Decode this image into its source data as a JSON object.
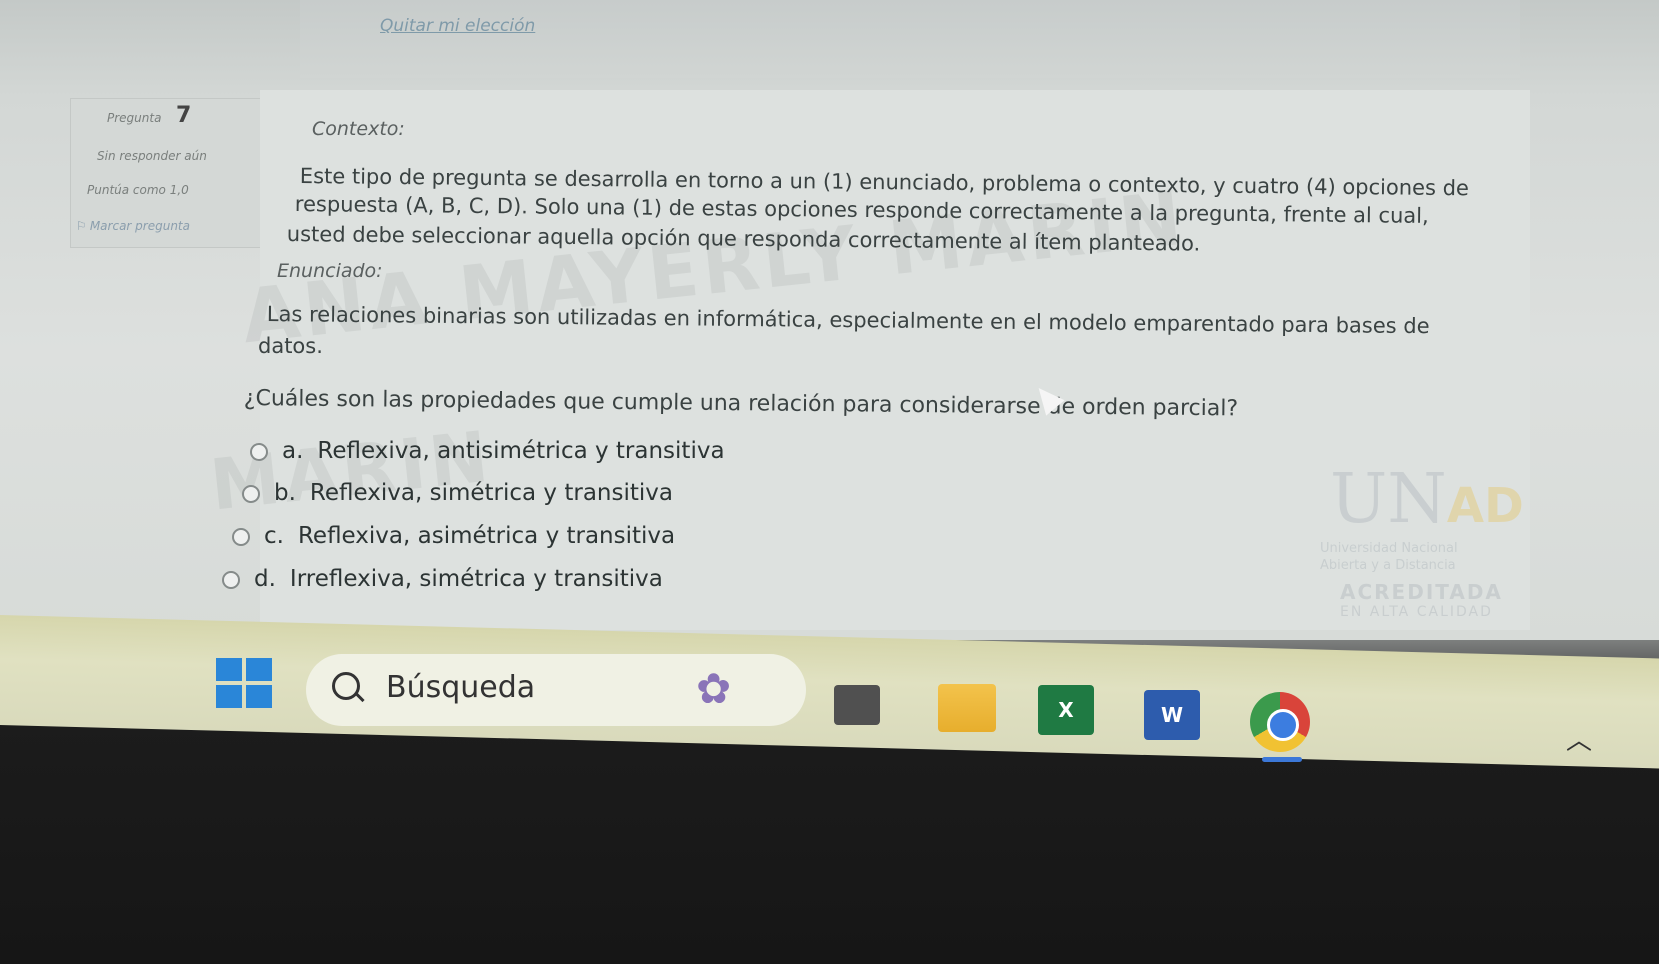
{
  "header": {
    "clear_choice": "Quitar mi elección"
  },
  "question_info": {
    "label": "Pregunta",
    "number": "7",
    "status": "Sin responder aún",
    "score": "Puntúa como 1,0",
    "flag": "Marcar pregunta"
  },
  "question": {
    "context_label": "Contexto:",
    "context_lines": [
      "Este tipo de pregunta se desarrolla en torno a un (1) enunciado, problema o contexto, y cuatro (4) opciones de",
      "respuesta (A, B, C, D). Solo una (1) de estas opciones responde correctamente a la pregunta, frente al cual,",
      "usted debe seleccionar aquella opción que responda correctamente al ítem planteado."
    ],
    "statement_label": "Enunciado:",
    "statement_lines": [
      "Las relaciones binarias son utilizadas en informática, especialmente en el modelo emparentado para bases de",
      "datos."
    ],
    "prompt": "¿Cuáles son las propiedades que cumple una relación para considerarse de orden parcial?",
    "options": [
      {
        "letter": "a.",
        "text": "Reflexiva, antisimétrica y transitiva"
      },
      {
        "letter": "b.",
        "text": "Reflexiva, simétrica y transitiva"
      },
      {
        "letter": "c.",
        "text": "Reflexiva, asimétrica y transitiva"
      },
      {
        "letter": "d.",
        "text": "Irreflexiva, simétrica y transitiva"
      }
    ]
  },
  "watermark": {
    "line1": "ANA MAYERLY MARIN",
    "line2": "MARIN"
  },
  "logo": {
    "name": "UN",
    "name_accent": "AD",
    "sub1": "Universidad Nacional",
    "sub2": "Abierta y a Distancia",
    "accredited": "ACREDITADA",
    "quality": "EN ALTA CALIDAD"
  },
  "taskbar": {
    "search_label": "Búsqueda",
    "excel_letter": "X",
    "word_letter": "W"
  }
}
